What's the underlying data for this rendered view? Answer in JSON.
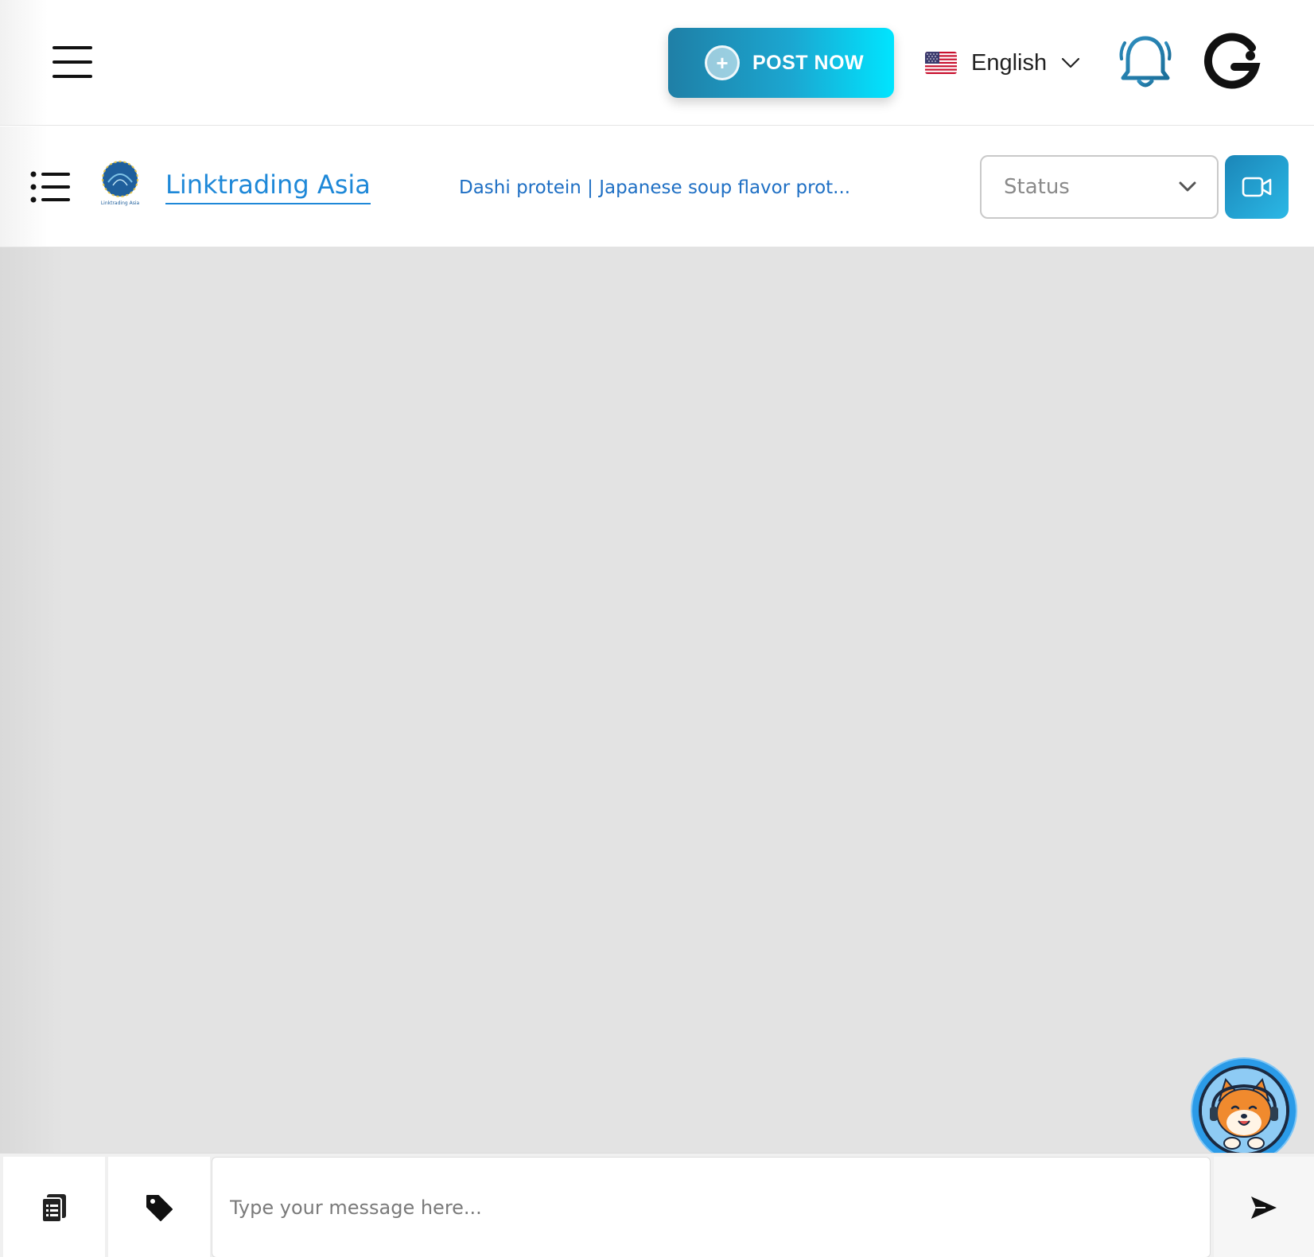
{
  "topnav": {
    "post_button_label": "POST NOW",
    "language": {
      "selected": "English",
      "flag": "us-flag-icon"
    },
    "icons": [
      "menu-icon",
      "plus-circle-icon",
      "chevron-down-icon",
      "bell-icon",
      "g-logo-icon"
    ]
  },
  "chat_header": {
    "company_name": "Linktrading Asia",
    "company_logo_text": "Linktrading Asia",
    "product_title": "Dashi protein | Japanese soup flavor prot...",
    "status_placeholder": "Status",
    "icons": [
      "list-icon",
      "chevron-down-icon",
      "video-camera-icon"
    ]
  },
  "composer": {
    "placeholder": "Type your message here...",
    "icons": [
      "clipboard-list-icon",
      "tag-icon",
      "send-icon"
    ]
  },
  "support": {
    "icon": "shiba-support-avatar"
  },
  "colors": {
    "accent_gradient_start": "#1f7fa6",
    "accent_gradient_end": "#00e5ff",
    "link_blue": "#1e88d8",
    "messages_bg": "#e3e3e3"
  }
}
